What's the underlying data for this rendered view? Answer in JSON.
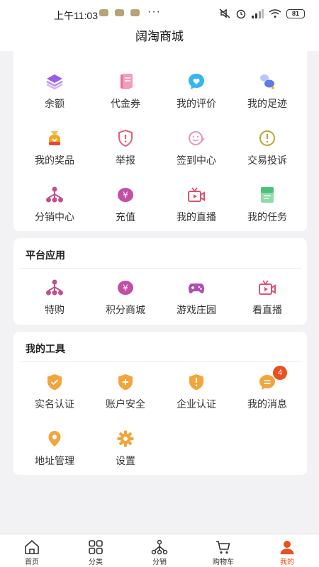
{
  "status": {
    "time": "上午11:03",
    "dots": "···",
    "battery": "81"
  },
  "header": {
    "title": "阔淘商城"
  },
  "top_grid": {
    "items": [
      {
        "label": "余额",
        "icon": "layers-icon",
        "color": "#9b5de5"
      },
      {
        "label": "代金券",
        "icon": "coupon-icon",
        "color": "#ef6b9b"
      },
      {
        "label": "我的评价",
        "icon": "chat-heart-icon",
        "color": "#35b6f0"
      },
      {
        "label": "我的足迹",
        "icon": "footprint-icon",
        "color": "#5b7be6"
      },
      {
        "label": "我的奖品",
        "icon": "prize-bag-icon",
        "color": "#f5a623"
      },
      {
        "label": "举报",
        "icon": "report-shield-icon",
        "color": "#e0627a"
      },
      {
        "label": "签到中心",
        "icon": "sign-in-icon",
        "color": "#e59ab5"
      },
      {
        "label": "交易投诉",
        "icon": "complaint-icon",
        "color": "#b7a43a"
      },
      {
        "label": "分销中心",
        "icon": "distribution-icon",
        "color": "#c0508e"
      },
      {
        "label": "充值",
        "icon": "yuan-coin-icon",
        "color": "#c24fa7"
      },
      {
        "label": "我的直播",
        "icon": "live-camera-icon",
        "color": "#e0506d"
      },
      {
        "label": "我的任务",
        "icon": "task-doc-icon",
        "color": "#4cc17a"
      }
    ]
  },
  "platform": {
    "title": "平台应用",
    "items": [
      {
        "label": "特购",
        "icon": "distribution-icon",
        "color": "#c0508e"
      },
      {
        "label": "积分商城",
        "icon": "yuan-coin-icon",
        "color": "#c24fa7"
      },
      {
        "label": "游戏庄园",
        "icon": "gamepad-icon",
        "color": "#b04fb2"
      },
      {
        "label": "看直播",
        "icon": "live-camera-icon",
        "color": "#e0506d"
      }
    ]
  },
  "tools": {
    "title": "我的工具",
    "items": [
      {
        "label": "实名认证",
        "icon": "verified-shield-icon",
        "color": "#f3a43b"
      },
      {
        "label": "账户安全",
        "icon": "security-shield-icon",
        "color": "#f3a43b"
      },
      {
        "label": "企业认证",
        "icon": "enterprise-shield-icon",
        "color": "#f3a43b"
      },
      {
        "label": "我的消息",
        "icon": "message-icon",
        "color": "#f3a43b",
        "badge": "4"
      },
      {
        "label": "地址管理",
        "icon": "location-pin-icon",
        "color": "#f3a43b"
      },
      {
        "label": "设置",
        "icon": "settings-gear-icon",
        "color": "#f3a43b"
      }
    ]
  },
  "tabbar": {
    "items": [
      {
        "label": "首页",
        "icon": "home-icon"
      },
      {
        "label": "分类",
        "icon": "category-grid-icon"
      },
      {
        "label": "分销",
        "icon": "distribution-icon"
      },
      {
        "label": "购物车",
        "icon": "cart-icon"
      },
      {
        "label": "我的",
        "icon": "user-icon",
        "active": true
      }
    ],
    "active_color": "#e8521f"
  }
}
